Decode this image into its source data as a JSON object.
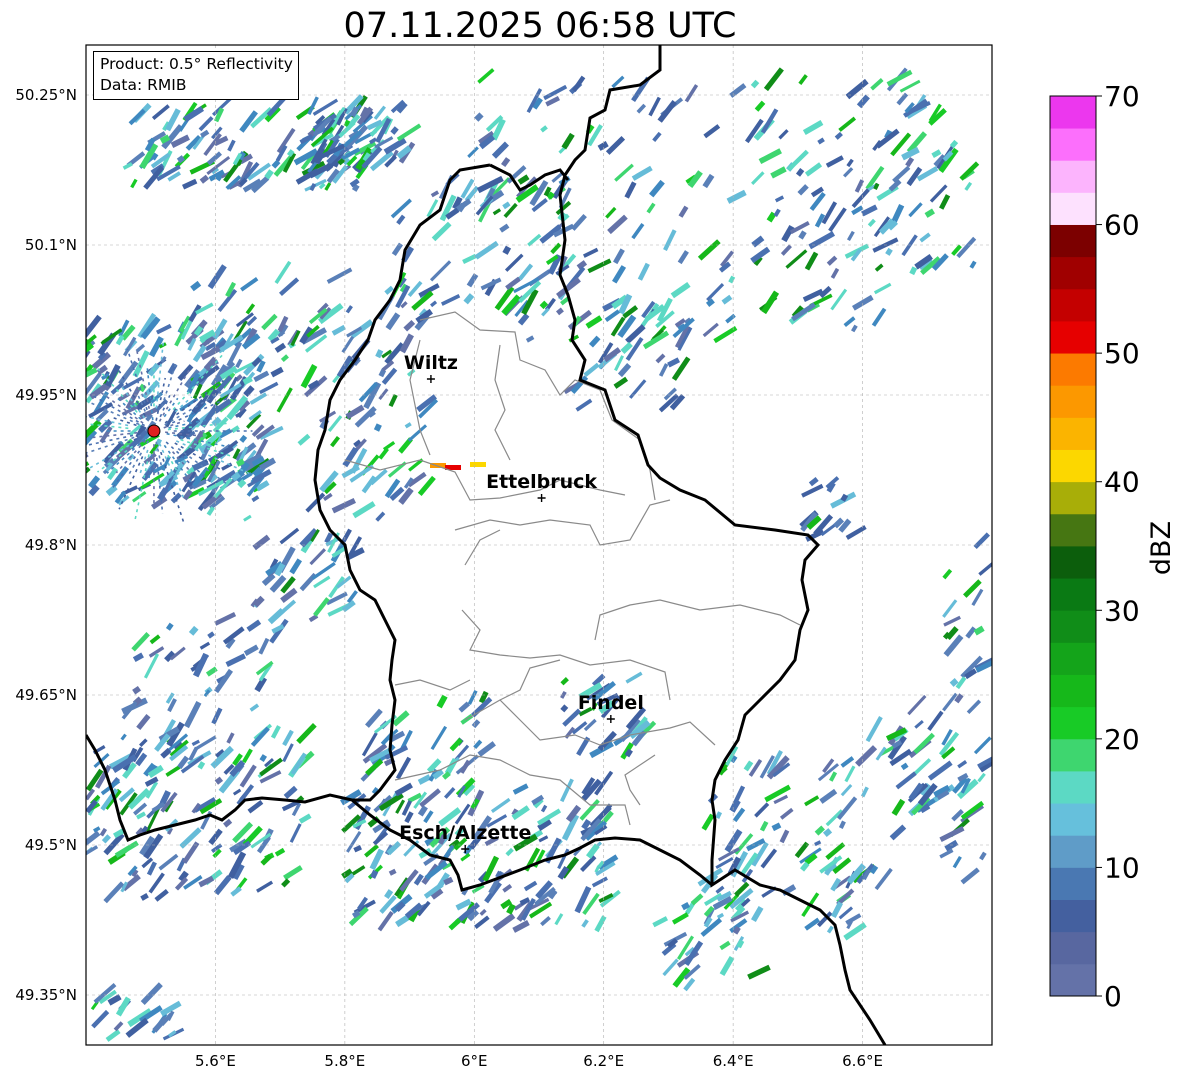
{
  "title": "07.11.2025 06:58 UTC",
  "info_box": {
    "line1": "Product: 0.5° Reflectivity",
    "line2": "Data: RMIB"
  },
  "map": {
    "lon_range": [
      5.4,
      6.8
    ],
    "lat_range": [
      49.3,
      50.3
    ],
    "lat_ticks": [
      "50.25°N",
      "50.1°N",
      "49.95°N",
      "49.8°N",
      "49.65°N",
      "49.5°N",
      "49.35°N"
    ],
    "lat_tick_values": [
      50.25,
      50.1,
      49.95,
      49.8,
      49.65,
      49.5,
      49.35
    ],
    "lon_ticks": [
      "5.6°E",
      "5.8°E",
      "6°E",
      "6.2°E",
      "6.4°E",
      "6.6°E"
    ],
    "lon_tick_values": [
      5.6,
      5.8,
      6.0,
      6.2,
      6.4,
      6.6
    ],
    "gridlines": true,
    "radar_site": {
      "lon": 5.505,
      "lat": 49.914,
      "color": "#e02020"
    },
    "cities": [
      {
        "name": "Wiltz",
        "lon": 5.933,
        "lat": 49.966
      },
      {
        "name": "Ettelbruck",
        "lon": 6.104,
        "lat": 49.847
      },
      {
        "name": "Findel",
        "lon": 6.211,
        "lat": 49.626
      },
      {
        "name": "Esch/Alzette",
        "lon": 5.986,
        "lat": 49.496
      }
    ]
  },
  "colorbar": {
    "label": "dBZ",
    "min": 0,
    "max": 70,
    "tick_labels": [
      "0",
      "10",
      "20",
      "30",
      "40",
      "50",
      "60",
      "70"
    ],
    "tick_values": [
      0,
      10,
      20,
      30,
      40,
      50,
      60,
      70
    ],
    "step": 2.5,
    "colors": [
      "#6472a8",
      "#5867a0",
      "#44609f",
      "#4a78b2",
      "#5f9cc8",
      "#66c0dc",
      "#5cd9c4",
      "#3ed66f",
      "#18cb26",
      "#16b81a",
      "#14a41a",
      "#108d18",
      "#0a7a14",
      "#0c5e0c",
      "#467612",
      "#a8ae08",
      "#fcd700",
      "#fbb400",
      "#fc9800",
      "#fc7a00",
      "#e60000",
      "#c40000",
      "#a00000",
      "#7c0000",
      "#fde1fe",
      "#fcb4fd",
      "#fc6ffc",
      "#ec37ee"
    ]
  }
}
